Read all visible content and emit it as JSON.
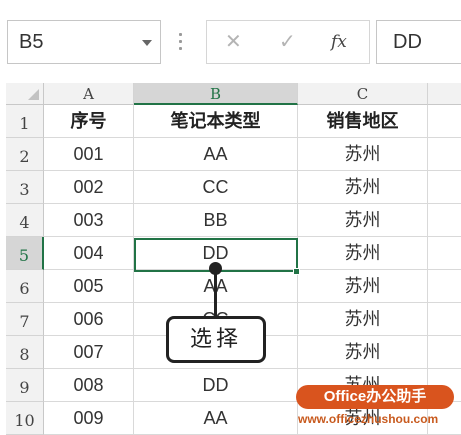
{
  "formula_bar": {
    "name_box": "B5",
    "cancel_symbol": "✕",
    "enter_symbol": "✓",
    "fx_label": "fx",
    "formula_value": "DD"
  },
  "columns": [
    "A",
    "B",
    "C"
  ],
  "rows": [
    "1",
    "2",
    "3",
    "4",
    "5",
    "6",
    "7",
    "8",
    "9",
    "10"
  ],
  "table": {
    "headers": [
      "序号",
      "笔记本类型",
      "销售地区"
    ],
    "data": [
      [
        "001",
        "AA",
        "苏州"
      ],
      [
        "002",
        "CC",
        "苏州"
      ],
      [
        "003",
        "BB",
        "苏州"
      ],
      [
        "004",
        "DD",
        "苏州"
      ],
      [
        "005",
        "AA",
        "苏州"
      ],
      [
        "006",
        "CC",
        "苏州"
      ],
      [
        "007",
        "",
        "苏州"
      ],
      [
        "008",
        "DD",
        "苏州"
      ],
      [
        "009",
        "AA",
        "苏州"
      ]
    ]
  },
  "callout": {
    "label": "选择"
  },
  "watermark": {
    "logo": "Office办公助手",
    "url": "www.officezhushou.com"
  },
  "colors": {
    "selection": "#217346",
    "watermark": "#d9541e"
  }
}
